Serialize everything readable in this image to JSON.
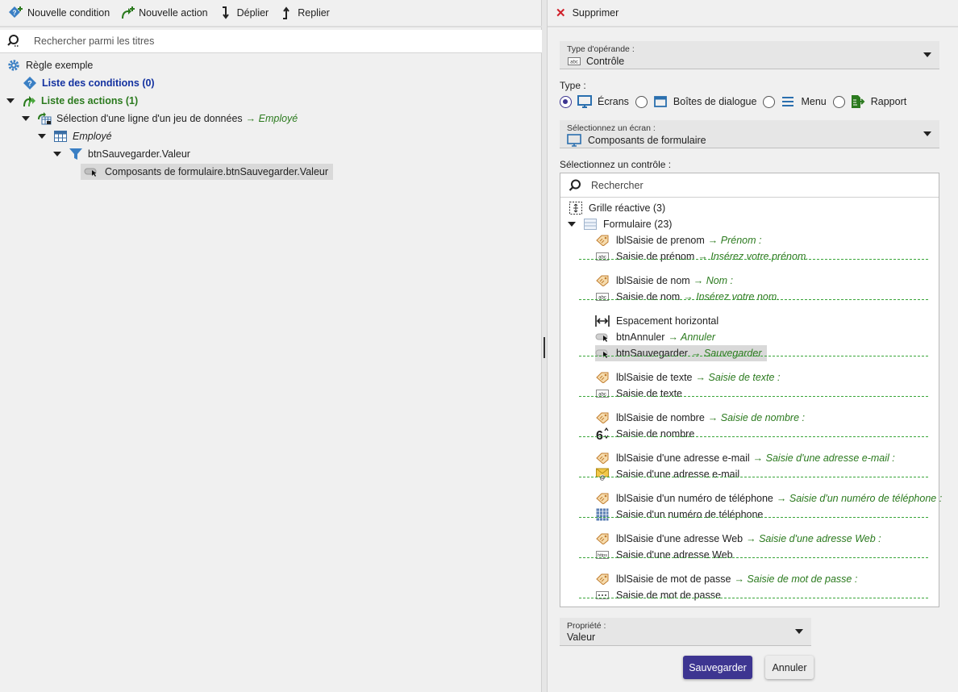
{
  "toolbar": {
    "new_condition": "Nouvelle condition",
    "new_action": "Nouvelle action",
    "expand": "Déplier",
    "collapse": "Replier"
  },
  "search": {
    "placeholder": "Rechercher parmi les titres"
  },
  "tree": {
    "rule": "Règle exemple",
    "conditions": "Liste des conditions (0)",
    "actions": "Liste des actions (1)",
    "selection": "Sélection d'une ligne d'un jeu de données",
    "selection_target": "→ Employé",
    "dataset": "Employé",
    "filter": "btnSauvegarder.Valeur",
    "value": "Composants de formulaire.btnSauvegarder.Valeur"
  },
  "right": {
    "delete": "Supprimer",
    "operand_type_label": "Type d'opérande :",
    "operand_type_value": "Contrôle",
    "type_label": "Type :",
    "types": [
      "Écrans",
      "Boîtes de dialogue",
      "Menu",
      "Rapport"
    ],
    "screen_label": "Sélectionnez un écran :",
    "screen_value": "Composants de formulaire",
    "control_label": "Sélectionnez un contrôle :",
    "control_search_placeholder": "Rechercher",
    "grid": "Grille réactive (3)",
    "form": "Formulaire (23)",
    "controls": [
      {
        "name": "lblSaisie de prenom",
        "target": "→ Prénom :",
        "icon": "label-tag-icon"
      },
      {
        "name": "Saisie de prénom",
        "target": "→ Insérez votre prénom.",
        "icon": "text-input-icon"
      },
      {
        "name": "lblSaisie de nom",
        "target": "→ Nom :",
        "icon": "label-tag-icon"
      },
      {
        "name": "Saisie de nom",
        "target": "→ Insérez votre nom.",
        "icon": "text-input-icon"
      },
      {
        "name": "Espacement horizontal",
        "target": "",
        "icon": "horizontal-spacer-icon"
      },
      {
        "name": "btnAnnuler",
        "target": "→ Annuler",
        "icon": "button-icon"
      },
      {
        "name": "btnSauvegarder",
        "target": "→ Sauvegarder",
        "icon": "button-icon"
      },
      {
        "name": "lblSaisie de texte",
        "target": "→ Saisie de texte :",
        "icon": "label-tag-icon"
      },
      {
        "name": "Saisie de texte",
        "target": "",
        "icon": "text-input-icon"
      },
      {
        "name": "lblSaisie de nombre",
        "target": "→ Saisie de nombre :",
        "icon": "label-tag-icon"
      },
      {
        "name": "Saisie de nombre",
        "target": "",
        "icon": "number-input-icon"
      },
      {
        "name": "lblSaisie d'une adresse e-mail",
        "target": "→ Saisie d'une adresse e-mail :",
        "icon": "label-tag-icon"
      },
      {
        "name": "Saisie d'une adresse e-mail",
        "target": "",
        "icon": "email-input-icon"
      },
      {
        "name": "lblSaisie d'un numéro de téléphone",
        "target": "→ Saisie d'un numéro de téléphone :",
        "icon": "label-tag-icon"
      },
      {
        "name": "Saisie d'un numéro de téléphone",
        "target": "",
        "icon": "phone-input-icon"
      },
      {
        "name": "lblSaisie d'une adresse Web",
        "target": "→ Saisie d'une adresse Web :",
        "icon": "label-tag-icon"
      },
      {
        "name": "Saisie d'une adresse Web",
        "target": "",
        "icon": "url-input-icon"
      },
      {
        "name": "lblSaisie de mot de passe",
        "target": "→ Saisie de mot de passe :",
        "icon": "label-tag-icon"
      },
      {
        "name": "Saisie de mot de passe",
        "target": "",
        "icon": "password-input-icon"
      }
    ],
    "property_label": "Propriété :",
    "property_value": "Valeur",
    "save": "Sauvegarder",
    "cancel": "Annuler"
  },
  "colors": {
    "accent": "#3d3591",
    "green": "#2b7a1e",
    "blue": "#1432a0",
    "delete": "#d0202a"
  }
}
